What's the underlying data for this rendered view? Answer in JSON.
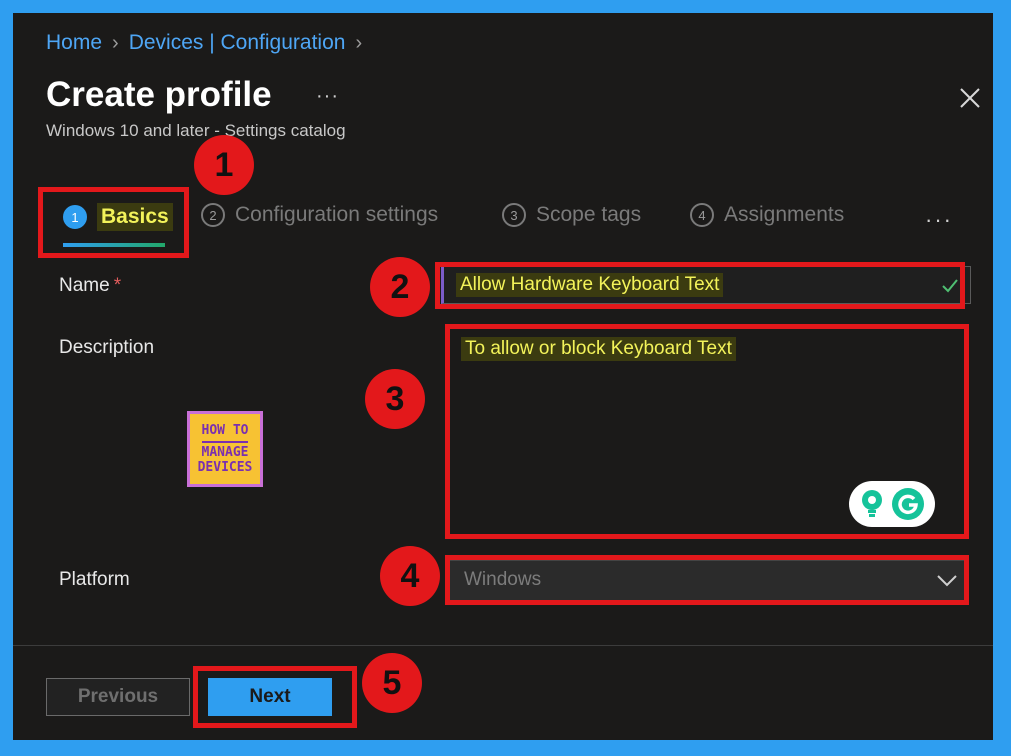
{
  "breadcrumb": {
    "home": "Home",
    "section": "Devices | Configuration"
  },
  "header": {
    "title": "Create profile",
    "more": "···",
    "subtitle": "Windows 10 and later - Settings catalog"
  },
  "tabs": [
    {
      "num": "1",
      "label": "Basics",
      "active": true
    },
    {
      "num": "2",
      "label": "Configuration settings"
    },
    {
      "num": "3",
      "label": "Scope tags"
    },
    {
      "num": "4",
      "label": "Assignments"
    }
  ],
  "tabs_more": "···",
  "form": {
    "name_label": "Name",
    "required_mark": "*",
    "name_value": "Allow Hardware Keyboard Text",
    "description_label": "Description",
    "description_value": "To allow or block  Keyboard Text",
    "platform_label": "Platform",
    "platform_value": "Windows"
  },
  "footer": {
    "previous": "Previous",
    "next": "Next"
  },
  "annotations": [
    "1",
    "2",
    "3",
    "4",
    "5"
  ],
  "logo": {
    "line1": "HOW TO",
    "line2": "MANAGE",
    "line3": "DEVICES"
  },
  "colors": {
    "accent": "#2f9ef0",
    "highlight_red": "#e3181b",
    "highlight_text": "#f3f35a"
  }
}
